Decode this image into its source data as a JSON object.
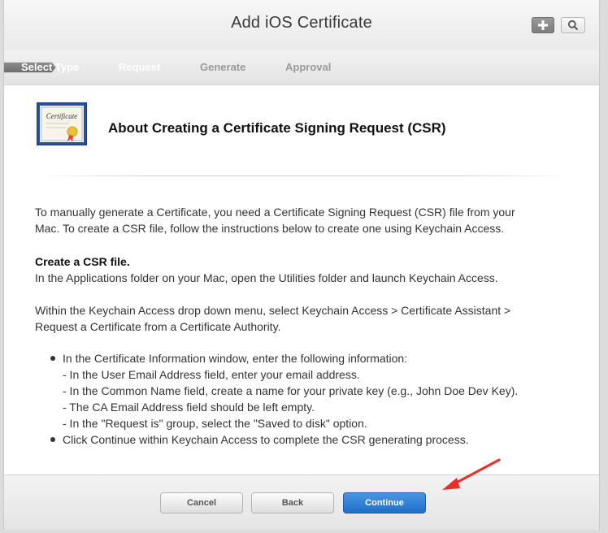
{
  "header": {
    "title": "Add iOS Certificate",
    "icons": [
      "plus-icon",
      "search-icon"
    ]
  },
  "steps": {
    "items": [
      {
        "label": "Select Type",
        "state": "completed"
      },
      {
        "label": "Request",
        "state": "active"
      },
      {
        "label": "Generate",
        "state": "pending"
      },
      {
        "label": "Approval",
        "state": "pending"
      }
    ]
  },
  "content": {
    "certificate_image_text": "Certificate",
    "heading": "About Creating a Certificate Signing Request (CSR)",
    "intro_line1": "To manually generate a Certificate, you need a Certificate Signing Request (CSR) file from your",
    "intro_line2": "Mac. To create a CSR file, follow the instructions below to create one using Keychain Access.",
    "csr_title": "Create a CSR file.",
    "csr_text": "In the Applications folder on your Mac, open the Utilities folder and launch Keychain Access.",
    "menu_line1": "Within the Keychain Access drop down menu, select Keychain Access > Certificate Assistant >",
    "menu_line2": "Request a Certificate from a Certificate Authority.",
    "bullet1": "In the Certificate Information window, enter the following information:",
    "sub1": "- In the User Email Address field, enter your email address.",
    "sub2": "- In the Common Name field, create a name for your private key (e.g., John Doe Dev Key).",
    "sub3": "- The CA Email Address field should be left empty.",
    "sub4": "- In the \"Request is\" group, select the \"Saved to disk\" option.",
    "bullet2": "Click Continue within Keychain Access to complete the CSR generating process."
  },
  "footer": {
    "cancel_label": "Cancel",
    "back_label": "Back",
    "continue_label": "Continue"
  },
  "colors": {
    "active_step": "#7a7a7a",
    "continue_button": "#2a7bd2",
    "annotation_arrow": "#e8302a"
  }
}
